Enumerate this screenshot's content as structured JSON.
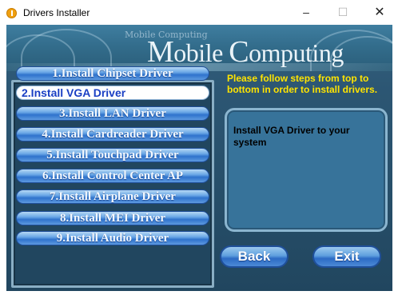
{
  "window": {
    "title": "Drivers Installer",
    "controls": {
      "minimize": "–",
      "maximize": "☐",
      "close": "✕"
    }
  },
  "banner": {
    "small_text": "Mobile Computing",
    "brand_first_letter": "M",
    "brand_first_rest": "obile ",
    "brand_second_letter": "C",
    "brand_second_rest": "omputing"
  },
  "steps": [
    {
      "label": "1.Install Chipset Driver",
      "selected": false
    },
    {
      "label": "2.Install VGA Driver",
      "selected": true
    },
    {
      "label": "3.Install LAN Driver",
      "selected": false
    },
    {
      "label": "4.Install Cardreader Driver",
      "selected": false
    },
    {
      "label": "5.Install Touchpad Driver",
      "selected": false
    },
    {
      "label": "6.Install Control Center AP",
      "selected": false
    },
    {
      "label": "7.Install Airplane Driver",
      "selected": false
    },
    {
      "label": "8.Install MEI Driver",
      "selected": false
    },
    {
      "label": "9.Install Audio Driver",
      "selected": false
    }
  ],
  "instructions": "Please follow steps from top to bottom in order to install drivers.",
  "description": "Install VGA Driver to your system",
  "buttons": {
    "back": "Back",
    "exit": "Exit"
  },
  "colors": {
    "instruction_text": "#ffe400",
    "selected_label": "#1a3fc4",
    "panel_background": "#2c5673"
  }
}
